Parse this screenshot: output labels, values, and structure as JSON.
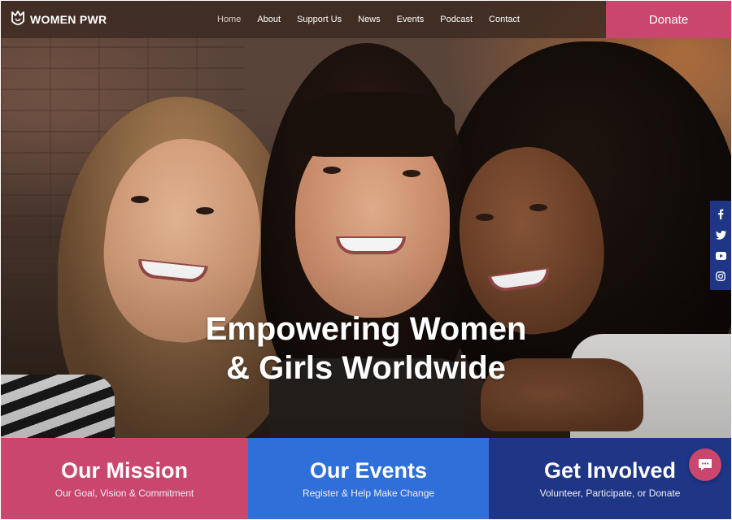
{
  "brand": {
    "name": "WOMEN PWR",
    "icon": "crown-shield-icon"
  },
  "nav": {
    "items": [
      {
        "label": "Home",
        "active": true
      },
      {
        "label": "About",
        "active": false
      },
      {
        "label": "Support Us",
        "active": false
      },
      {
        "label": "News",
        "active": false
      },
      {
        "label": "Events",
        "active": false
      },
      {
        "label": "Podcast",
        "active": false
      },
      {
        "label": "Contact",
        "active": false
      }
    ]
  },
  "donate": {
    "label": "Donate"
  },
  "hero": {
    "line1": "Empowering Women",
    "line2": "& Girls Worldwide",
    "image_alt_icon": "hero-photo"
  },
  "social": {
    "icons": [
      "facebook-icon",
      "twitter-icon",
      "youtube-icon",
      "instagram-icon"
    ]
  },
  "panels": [
    {
      "title": "Our Mission",
      "subtitle": "Our Goal, Vision & Commitment",
      "color": "#c9466c"
    },
    {
      "title": "Our Events",
      "subtitle": "Register & Help Make Change",
      "color": "#2f6fd9"
    },
    {
      "title": "Get Involved",
      "subtitle": "Volunteer, Participate, or Donate",
      "color": "#1f3687"
    }
  ],
  "chat": {
    "icon": "chat-bubble-icon"
  },
  "colors": {
    "accent_pink": "#c9466c",
    "accent_blue": "#2f6fd9",
    "accent_navy": "#1f3687",
    "header_bg": "#3a2820"
  }
}
